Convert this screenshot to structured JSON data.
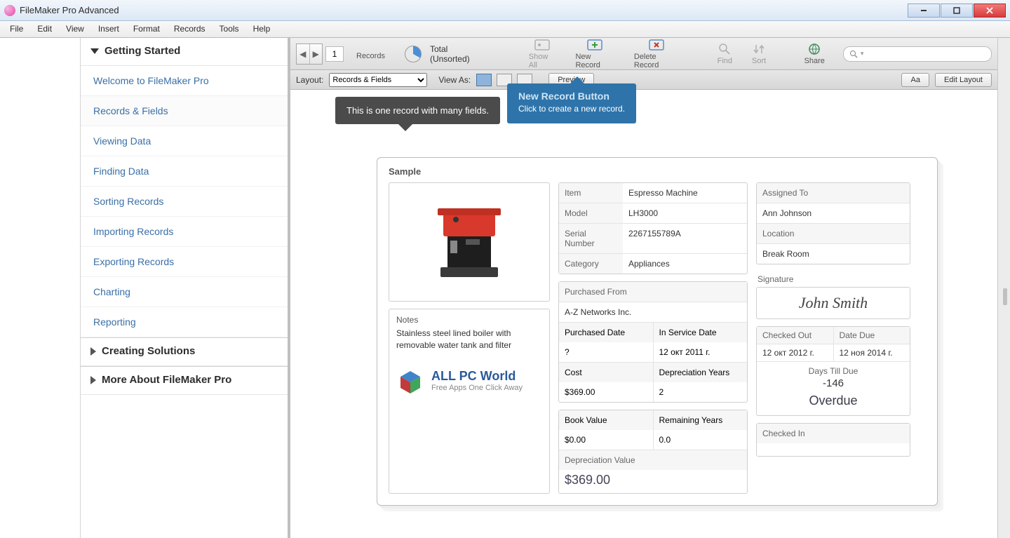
{
  "window": {
    "title": "FileMaker Pro Advanced"
  },
  "menubar": [
    "File",
    "Edit",
    "View",
    "Insert",
    "Format",
    "Records",
    "Tools",
    "Help"
  ],
  "sidebar": {
    "section_open": "Getting Started",
    "items": [
      "Welcome to FileMaker Pro",
      "Records & Fields",
      "Viewing Data",
      "Finding Data",
      "Sorting Records",
      "Importing Records",
      "Exporting Records",
      "Charting",
      "Reporting"
    ],
    "section2": "Creating Solutions",
    "section3": "More About FileMaker Pro"
  },
  "toolbar": {
    "page_current": "1",
    "total_label": "Total (Unsorted)",
    "records_label": "Records",
    "show_all": "Show All",
    "new_record": "New Record",
    "delete_record": "Delete Record",
    "find": "Find",
    "sort": "Sort",
    "share": "Share"
  },
  "layoutbar": {
    "layout_label": "Layout:",
    "layout_value": "Records & Fields",
    "view_as": "View As:",
    "preview": "Preview",
    "aa": "Aa",
    "edit_layout": "Edit Layout"
  },
  "tooltip_dark": "This is one record with many fields.",
  "callout": {
    "head": "New Record Button",
    "sub": "Click to create a new record."
  },
  "card": {
    "title": "Sample",
    "notes_label": "Notes",
    "notes": "Stainless steel lined boiler with removable water tank and filter",
    "watermark": {
      "big": "ALL PC World",
      "small": "Free Apps One Click Away"
    },
    "fields": {
      "item_k": "Item",
      "item_v": "Espresso Machine",
      "model_k": "Model",
      "model_v": "LH3000",
      "serial_k": "Serial Number",
      "serial_v": "2267155789A",
      "category_k": "Category",
      "category_v": "Appliances",
      "purch_from_k": "Purchased From",
      "purch_from_v": "A-Z Networks Inc.",
      "purch_date_k": "Purchased Date",
      "purch_date_v": "?",
      "inservice_k": "In Service Date",
      "inservice_v": "12 окт 2011 г.",
      "cost_k": "Cost",
      "cost_v": "$369.00",
      "dep_years_k": "Depreciation Years",
      "dep_years_v": "2",
      "book_k": "Book Value",
      "book_v": "$0.00",
      "remain_k": "Remaining Years",
      "remain_v": "0.0",
      "dep_val_k": "Depreciation Value",
      "dep_val_v": "$369.00",
      "assigned_k": "Assigned To",
      "assigned_v": "Ann Johnson",
      "location_k": "Location",
      "location_v": "Break Room",
      "signature_k": "Signature",
      "signature_v": "John Smith",
      "checked_out_k": "Checked Out",
      "checked_out_v": "12 окт 2012 г.",
      "date_due_k": "Date Due",
      "date_due_v": "12 ноя 2014 г.",
      "days_due_k": "Days Till Due",
      "days_due_v": "-146",
      "overdue": "Overdue",
      "checked_in_k": "Checked In"
    }
  }
}
